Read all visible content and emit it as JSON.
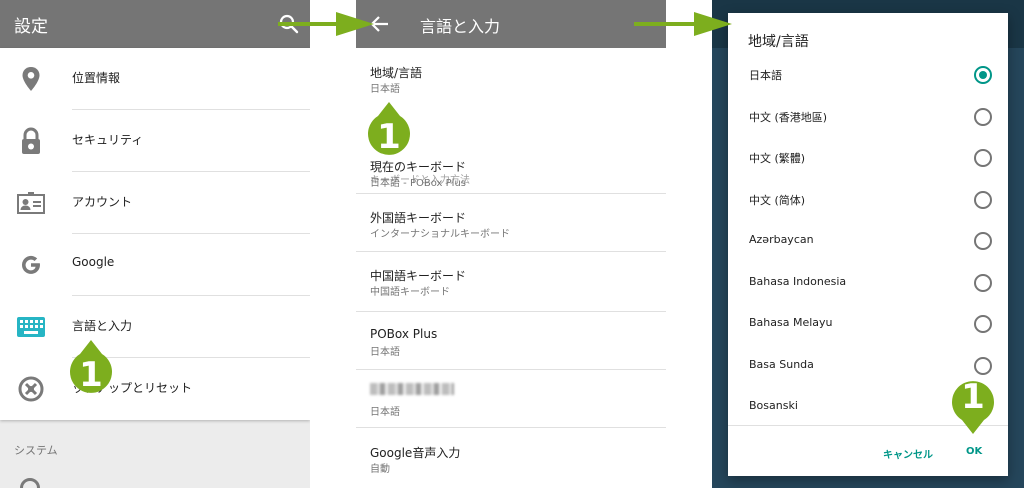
{
  "colors": {
    "appbar": "#757575",
    "accent": "#009688",
    "arrow_green": "#7dae1e",
    "dialog_backdrop": "#25465b"
  },
  "settings": {
    "title": "設定",
    "items": [
      {
        "label": "位置情報",
        "icon": "location-icon"
      },
      {
        "label": "セキュリティ",
        "icon": "lock-icon"
      },
      {
        "label": "アカウント",
        "icon": "account-card-icon"
      },
      {
        "label": "Google",
        "icon": "google-icon"
      },
      {
        "label": "言語と入力",
        "icon": "keyboard-icon"
      },
      {
        "label": "ックアップとリセット",
        "icon": "backup-icon"
      }
    ],
    "section_label": "システム"
  },
  "language_input": {
    "title": "言語と入力",
    "locale": {
      "title": "地域/言語",
      "subtitle": "日本語"
    },
    "category_label": "キーボードと入力方法",
    "keyboards": [
      {
        "title": "現在のキーボード",
        "subtitle": "日本語 - POBox Plus"
      },
      {
        "title": "外国語キーボード",
        "subtitle": "インターナショナルキーボード"
      },
      {
        "title": "中国語キーボード",
        "subtitle": "中国語キーボード"
      },
      {
        "title": "POBox Plus",
        "subtitle": "日本語"
      },
      {
        "title": "",
        "subtitle": "日本語"
      },
      {
        "title": "Google音声入力",
        "subtitle": "自動"
      }
    ]
  },
  "dialog": {
    "title": "地域/言語",
    "options": [
      {
        "label": "日本語",
        "selected": true
      },
      {
        "label": "中文 (香港地區)",
        "selected": false
      },
      {
        "label": "中文 (繁體)",
        "selected": false
      },
      {
        "label": "中文 (简体)",
        "selected": false
      },
      {
        "label": "Azərbaycan",
        "selected": false
      },
      {
        "label": "Bahasa Indonesia",
        "selected": false
      },
      {
        "label": "Bahasa Melayu",
        "selected": false
      },
      {
        "label": "Basa Sunda",
        "selected": false
      },
      {
        "label": "Bosanski",
        "selected": false
      }
    ],
    "cancel_label": "キャンセル",
    "ok_label": "OK"
  },
  "markers": {
    "step": "1"
  }
}
